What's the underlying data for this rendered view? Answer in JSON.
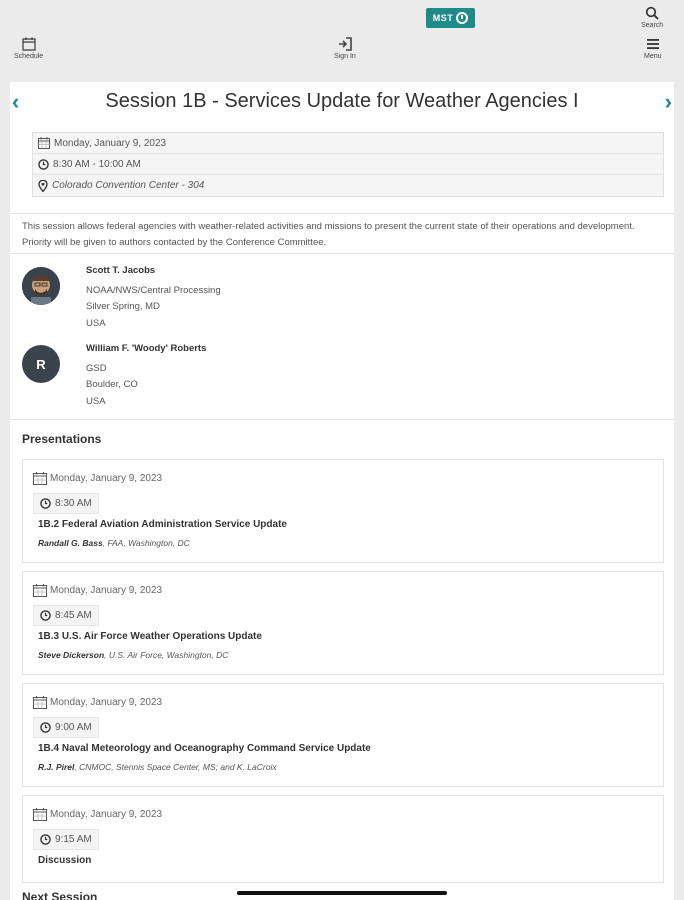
{
  "toolbar": {
    "schedule_label": "Schedule",
    "signin_label": "Sign In",
    "menu_label": "Menu",
    "search_label": "Search",
    "logo_text": "MST",
    "accent_color": "#1f8a8a"
  },
  "session": {
    "title": "Session 1B - Services Update for Weather Agencies I",
    "date": "Monday, January 9, 2023",
    "time": "8:30 AM - 10:00 AM",
    "location": "Colorado Convention Center - 304",
    "description": "This session allows federal agencies with weather-related activities and missions to present the current state of their operations and development. Priority will be given to authors contacted by the Conference Committee."
  },
  "chairs": [
    {
      "name": "Scott T. Jacobs",
      "org": "NOAA/NWS/Central Processing",
      "city": "Silver Spring, MD",
      "country": "USA",
      "avatar": "photo"
    },
    {
      "name": "William F. 'Woody' Roberts",
      "org": "GSD",
      "city": "Boulder, CO",
      "country": "USA",
      "avatar_initial": "R"
    }
  ],
  "presentations_heading": "Presentations",
  "presentations": [
    {
      "date": "Monday, January 9, 2023",
      "time": "8:30 AM",
      "title": "1B.2 Federal Aviation Administration Service Update",
      "author": "Randall G. Bass",
      "affiliation": ", FAA, Washington, DC"
    },
    {
      "date": "Monday, January 9, 2023",
      "time": "8:45 AM",
      "title": "1B.3 U.S. Air Force Weather Operations Update",
      "author": "Steve Dickerson",
      "affiliation": ", U.S. Air Force, Washington, DC"
    },
    {
      "date": "Monday, January 9, 2023",
      "time": "9:00 AM",
      "title": "1B.4 Naval Meteorology and Oceanography Command Service Update",
      "author": "R.J. Pirel",
      "affiliation": ", CNMOC, Stennis Space Center, MS; and K. LaCroix"
    },
    {
      "date": "Monday, January 9, 2023",
      "time": "9:15 AM",
      "title": "Discussion",
      "author": "",
      "affiliation": ""
    }
  ],
  "next_section_heading": "Next Session"
}
